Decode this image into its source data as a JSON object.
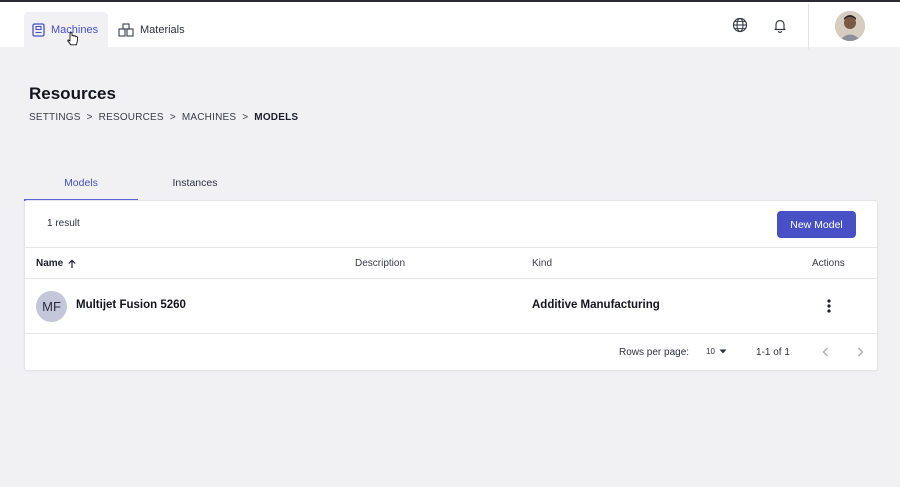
{
  "topbar": {
    "tabs": [
      {
        "label": "Machines",
        "icon": "machine-icon",
        "active": true
      },
      {
        "label": "Materials",
        "icon": "materials-icon",
        "active": false
      }
    ],
    "icons": [
      "globe-icon",
      "bell-icon"
    ]
  },
  "page": {
    "title": "Resources",
    "breadcrumb": [
      "SETTINGS",
      ">",
      "RESOURCES",
      ">",
      "MACHINES",
      ">",
      "MODELS"
    ]
  },
  "tabs": {
    "models": "Models",
    "instances": "Instances"
  },
  "table": {
    "result_count": "1 result",
    "new_button": "New Model",
    "columns": {
      "name": "Name",
      "description": "Description",
      "kind": "Kind",
      "actions": "Actions"
    },
    "rows": [
      {
        "initials": "MF",
        "name": "Multijet Fusion 5260",
        "description": "",
        "kind": "Additive Manufacturing"
      }
    ],
    "footer": {
      "rows_per_page_label": "Rows per page:",
      "rows_per_page_value": "10",
      "range": "1-1 of 1"
    }
  },
  "colors": {
    "accent": "#4750c4",
    "background": "#f1f1f4"
  }
}
